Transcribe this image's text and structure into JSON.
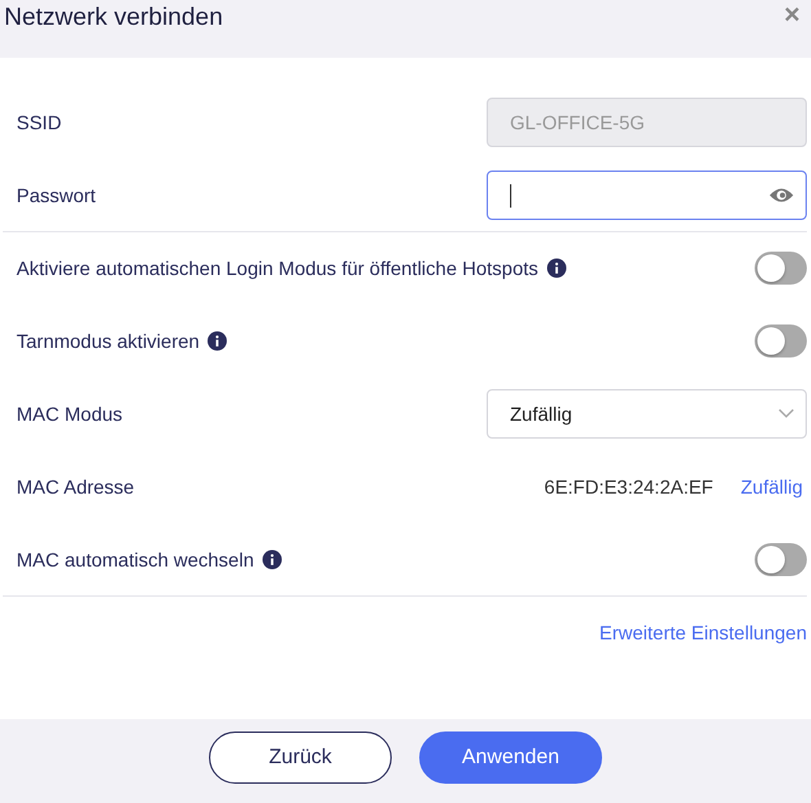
{
  "window": {
    "title": "Netzwerk verbinden",
    "close": "×"
  },
  "rows": [
    {
      "kind": "text",
      "label": "SSID",
      "value": "GL-OFFICE-5G",
      "disabled": true,
      "divider_after": false
    },
    {
      "kind": "password",
      "label": "Passwort",
      "value": "",
      "focused": true,
      "divider_after": true
    },
    {
      "kind": "toggle",
      "label": "Aktiviere automatischen Login Modus für öffentliche Hotspots",
      "info": true,
      "on": false,
      "divider_after": false
    },
    {
      "kind": "toggle",
      "label": "Tarnmodus aktivieren",
      "info": true,
      "on": false,
      "divider_after": false
    },
    {
      "kind": "select",
      "label": "MAC Modus",
      "value": "Zufällig",
      "divider_after": false
    },
    {
      "kind": "mac",
      "label": "MAC Adresse",
      "value": "6E:FD:E3:24:2A:EF",
      "link": "Zufällig",
      "divider_after": false
    },
    {
      "kind": "toggle",
      "label": "MAC automatisch wechseln",
      "info": true,
      "on": false,
      "divider_after": true
    }
  ],
  "advanced_link": "Erweiterte Einstellungen",
  "buttons": [
    {
      "label": "Zurück",
      "primary": false
    },
    {
      "label": "Anwenden",
      "primary": true
    }
  ]
}
